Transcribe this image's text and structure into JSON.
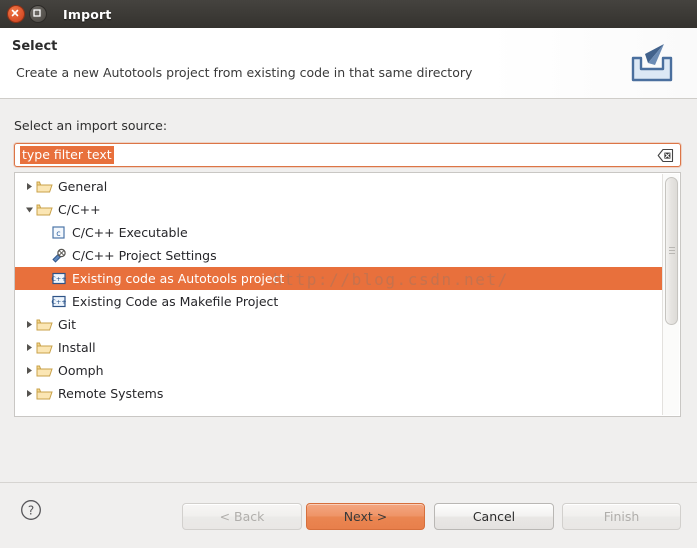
{
  "window": {
    "title": "Import",
    "close_icon": "close-icon",
    "maximize_icon": "maximize-icon"
  },
  "header": {
    "title": "Select",
    "subtitle": "Create a new Autotools project from existing code in that same directory",
    "icon": "import-tray-arrow-icon"
  },
  "body": {
    "label": "Select an import source:"
  },
  "filter": {
    "value": "type filter text",
    "placeholder": "type filter text",
    "clear_icon": "clear-filter-icon",
    "selected": true
  },
  "tree": {
    "items": [
      {
        "label": "General",
        "icon": "folder-icon",
        "twisty": "collapsed",
        "level": 0,
        "selected": false
      },
      {
        "label": "C/C++",
        "icon": "folder-icon",
        "twisty": "expanded",
        "level": 0,
        "selected": false
      },
      {
        "label": "C/C++ Executable",
        "icon": "c-file-icon",
        "twisty": "none",
        "level": 1,
        "selected": false
      },
      {
        "label": "C/C++ Project Settings",
        "icon": "settings-icon",
        "twisty": "none",
        "level": 1,
        "selected": false
      },
      {
        "label": "Existing code as Autotools project",
        "icon": "cpp-file-icon",
        "twisty": "none",
        "level": 1,
        "selected": true
      },
      {
        "label": "Existing Code as Makefile Project",
        "icon": "cpp-file-icon",
        "twisty": "none",
        "level": 1,
        "selected": false
      },
      {
        "label": "Git",
        "icon": "folder-icon",
        "twisty": "collapsed",
        "level": 0,
        "selected": false
      },
      {
        "label": "Install",
        "icon": "folder-icon",
        "twisty": "collapsed",
        "level": 0,
        "selected": false
      },
      {
        "label": "Oomph",
        "icon": "folder-icon",
        "twisty": "collapsed",
        "level": 0,
        "selected": false
      },
      {
        "label": "Remote Systems",
        "icon": "folder-icon",
        "twisty": "collapsed",
        "level": 0,
        "selected": false
      }
    ],
    "scrollbar": "vertical-scrollbar"
  },
  "footer": {
    "help_icon": "help-icon",
    "buttons": [
      {
        "label": "< Back",
        "state": "disabled"
      },
      {
        "label": "Next >",
        "state": "primary"
      },
      {
        "label": "Cancel",
        "state": "normal"
      },
      {
        "label": "Finish",
        "state": "disabled"
      }
    ]
  },
  "watermark": {
    "text": "http://blog.csdn.net/"
  },
  "colors": {
    "selection": "#e8703c",
    "accent": "#e8703c",
    "titlebar": "#3b3935",
    "panel": "#f0efee"
  }
}
